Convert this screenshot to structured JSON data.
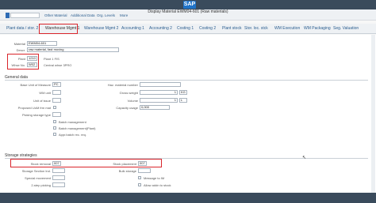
{
  "shell": {
    "logo": "SAP"
  },
  "window": {
    "title": "Display Material EWM04-601 (Raw materials)"
  },
  "toolbar": {
    "buttons": [
      "Other Material",
      "Additional Data",
      "Org. Levels",
      "More"
    ]
  },
  "tabs": {
    "items": [
      "Plant data / stor. 2",
      "Warehouse Mgmt 1",
      "Warehouse Mgmt 2",
      "Accounting 1",
      "Accounting 2",
      "Costing 1",
      "Costing 2",
      "Plant stock",
      "Stor. loc. stck",
      "WM Execution",
      "WM Packaging",
      "Seg. Valuation"
    ]
  },
  "header": {
    "material_label": "Material",
    "material_value": "EWM04-601",
    "descr_label": "Descr.",
    "descr_value": "raw material, fast moving",
    "plant_label": "Plant",
    "plant_value": "1210",
    "plant_text": "Plant 1 FIS",
    "whse_label": "Whse No.",
    "whse_value": "W02",
    "whse_text": "Central whse 3PRO"
  },
  "general": {
    "title": "General data",
    "base_uom_label": "Base Unit of Measure",
    "base_uom_value": "PC",
    "wm_unit_label": "WM unit",
    "wm_unit_value": "",
    "uoi_label": "Unit of issue",
    "proposed_label": "Proposed UoM frm mat",
    "picking_label": "Picking storage type",
    "haz_label": "Haz. material number",
    "gross_label": "Gross weight",
    "gross_value": "1",
    "gross_unit": "KG",
    "volume_label": "Volume",
    "volume_value": "1",
    "volume_unit": "L",
    "capacity_label": "Capacity usage",
    "capacity_value": "0,000",
    "batch_mgmt": "Batch management",
    "batch_mgmt_plant": "Batch management(Plant)",
    "appr_batch": "Appr.batch rec. req."
  },
  "storage": {
    "title": "Storage strategies",
    "removal_label": "Stock removal",
    "removal_value": "007",
    "placement_label": "Stock placement",
    "placement_value": "007",
    "section_label": "Storage Section Ind.",
    "bulk_label": "Bulk storage",
    "special_label": "Special movement",
    "message_im": "Message to IM",
    "two_step": "2-step picking",
    "allow_addn": "Allow addn to stock"
  }
}
